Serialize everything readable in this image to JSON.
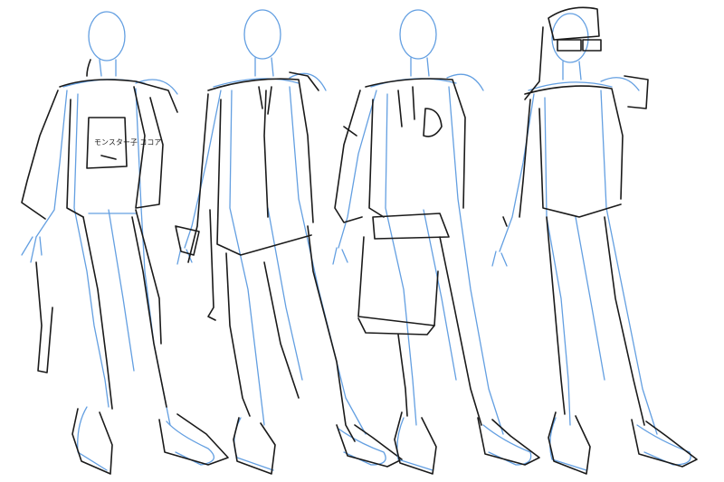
{
  "sketch": {
    "line_color": "#1a1a1a",
    "guide_color": "#5b9ae0",
    "background": "#ffffff",
    "figures": [
      {
        "id": "figure-1",
        "note": "モンスター子 ココア"
      },
      {
        "id": "figure-2",
        "note": ""
      },
      {
        "id": "figure-3",
        "note": ""
      },
      {
        "id": "figure-4",
        "note": ""
      }
    ]
  }
}
